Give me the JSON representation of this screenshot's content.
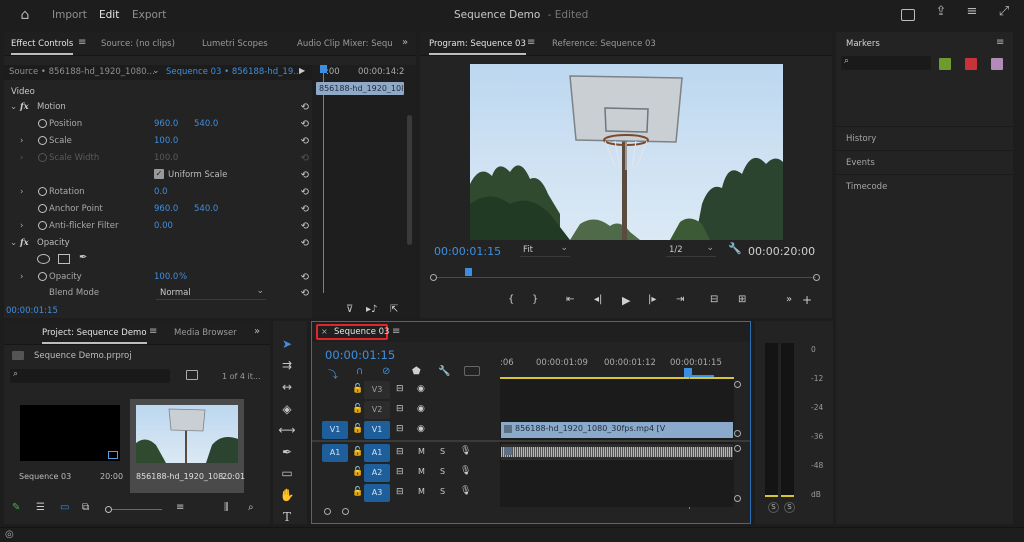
{
  "topbar": {
    "home_icon": "home-icon",
    "tabs": [
      "Import",
      "Edit",
      "Export"
    ],
    "active_tab": "Edit",
    "title": "Sequence Demo",
    "status": "- Edited",
    "right_icons": [
      "quick-export-icon",
      "share-icon",
      "workspaces-icon",
      "fullscreen-icon"
    ]
  },
  "effect_controls": {
    "tabs": [
      "Effect Controls",
      "Source: (no clips)",
      "Lumetri Scopes",
      "Audio Clip Mixer: Sequ"
    ],
    "source_label": "Source • 856188-hd_1920_1080...",
    "sequence_label": "Sequence 03 • 856188-hd_19...",
    "mini_timecode_a": ":00",
    "mini_timecode_b": "00:00:14:2",
    "mini_clip": "856188-hd_1920_108",
    "video_section": "Video",
    "motion": "Motion",
    "position": {
      "label": "Position",
      "x": "960.0",
      "y": "540.0"
    },
    "scale": {
      "label": "Scale",
      "value": "100.0"
    },
    "scale_width": {
      "label": "Scale Width",
      "value": "100.0"
    },
    "uniform_scale": "Uniform Scale",
    "rotation": {
      "label": "Rotation",
      "value": "0.0"
    },
    "anchor_point": {
      "label": "Anchor Point",
      "x": "960.0",
      "y": "540.0"
    },
    "anti_flicker": {
      "label": "Anti-flicker Filter",
      "value": "0.00"
    },
    "opacity_section": "Opacity",
    "opacity": {
      "label": "Opacity",
      "value": "100.0",
      "unit": "%"
    },
    "blend_mode": {
      "label": "Blend Mode",
      "value": "Normal"
    },
    "timecode": "00:00:01:15"
  },
  "program": {
    "tabs": [
      "Program: Sequence 03",
      "Reference: Sequence 03"
    ],
    "timecode": "00:00:01:15",
    "fit": "Fit",
    "resolution": "1/2",
    "duration": "00:00:20:00",
    "playhead_fraction": 0.075
  },
  "markers": {
    "title": "Markers",
    "colors": [
      "#6f9a2d",
      "#c9323a",
      "#b48ab8"
    ],
    "items": [
      "History",
      "Events",
      "Timecode"
    ]
  },
  "project": {
    "tabs": [
      "Project: Sequence Demo",
      "Media Browser"
    ],
    "file": "Sequence Demo.prproj",
    "count": "1 of 4 it...",
    "items": [
      {
        "name": "Sequence 03",
        "duration": "20:00"
      },
      {
        "name": "856188-hd_1920_108...",
        "duration": "20:01"
      }
    ]
  },
  "timeline": {
    "tab": "Sequence 03",
    "timecode": "00:00:01:15",
    "ruler": [
      ":06",
      "00:00:01:09",
      "00:00:01:12",
      "00:00:01:15"
    ],
    "video_tracks": [
      "V3",
      "V2",
      "V1"
    ],
    "audio_tracks": [
      "A1",
      "A2",
      "A3"
    ],
    "source_v": "V1",
    "source_a": "A1",
    "clip_label": "856188-hd_1920_1080_30fps.mp4 [V"
  },
  "meter": {
    "ticks": [
      "0",
      "-12",
      "-24",
      "-36",
      "-48",
      "dB"
    ],
    "solo": [
      "S",
      "S"
    ]
  }
}
